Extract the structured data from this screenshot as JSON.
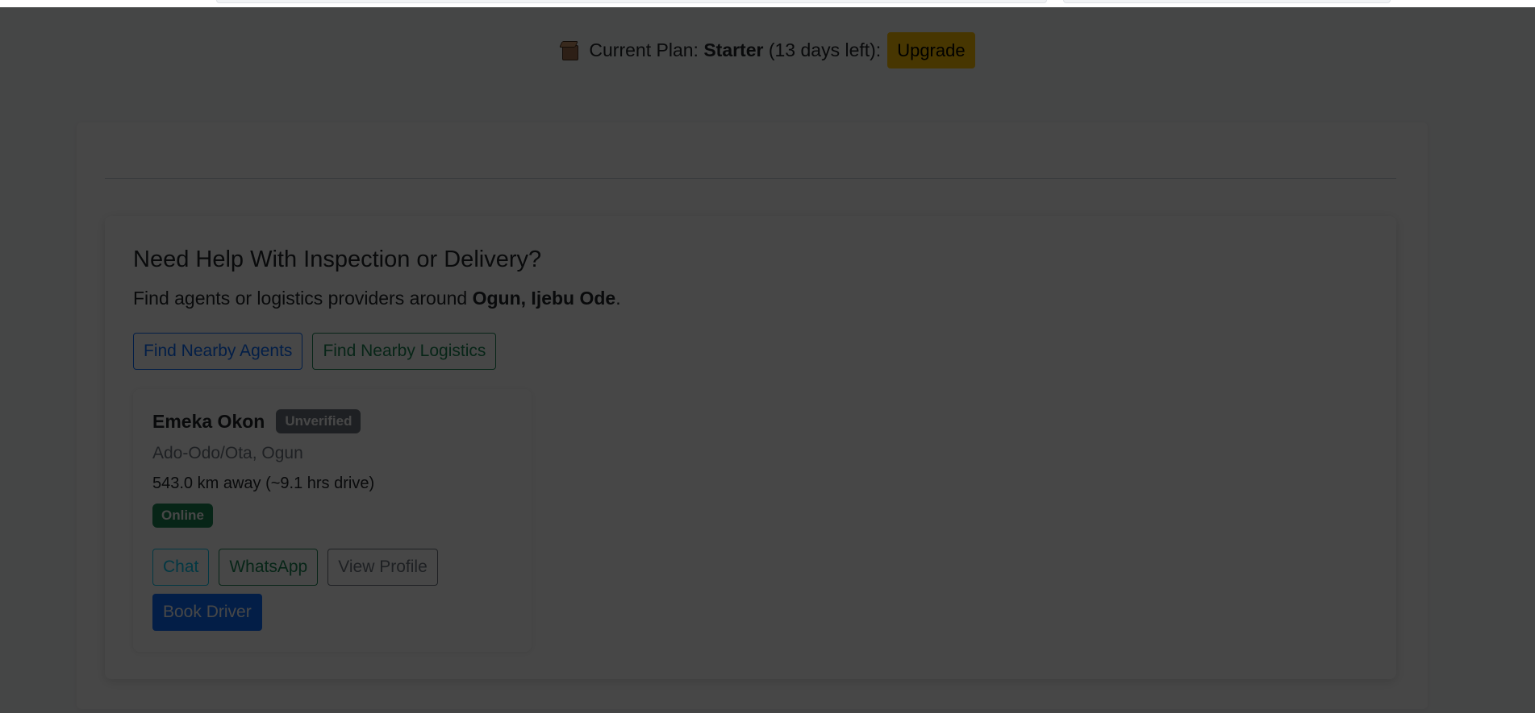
{
  "plan": {
    "label": "Current Plan:",
    "name": "Starter",
    "days_left": "(13 days left):",
    "upgrade_label": "Upgrade",
    "icon": "box-icon"
  },
  "help": {
    "title": "Need Help With Inspection or Delivery?",
    "subtitle_prefix": "Find agents or logistics providers around",
    "location": "Ogun, Ijebu Ode",
    "subtitle_suffix": ".",
    "find_agents_label": "Find Nearby Agents",
    "find_logistics_label": "Find Nearby Logistics"
  },
  "agents": [
    {
      "name": "Emeka Okon",
      "verification": "Unverified",
      "location": "Ado-Odo/Ota, Ogun",
      "distance": "543.0 km away (~9.1 hrs drive)",
      "status": "Online",
      "chat_label": "Chat",
      "whatsapp_label": "WhatsApp",
      "profile_label": "View Profile",
      "book_label": "Book Driver"
    }
  ],
  "colors": {
    "primary": "#0d6efd",
    "success": "#198754",
    "info": "#0dcaf0",
    "secondary": "#6c757d",
    "warning": "#ffc107",
    "overlay": "rgba(0,0,0,0.72)"
  }
}
